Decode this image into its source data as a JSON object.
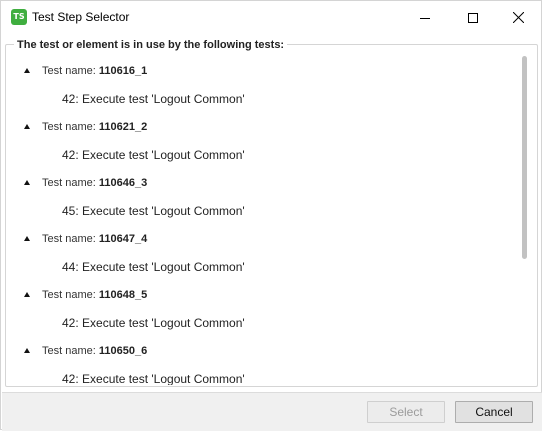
{
  "window": {
    "title": "Test Step Selector",
    "app_icon_text": "TS",
    "app_icon_color": "#3fae3f"
  },
  "group": {
    "header": "The test or element is in use by the following tests:"
  },
  "tests": [
    {
      "prefix": "Test name: ",
      "name": "110616_1",
      "step": "42: Execute test 'Logout Common'"
    },
    {
      "prefix": "Test name: ",
      "name": "110621_2",
      "step": "42: Execute test 'Logout Common'"
    },
    {
      "prefix": "Test name: ",
      "name": "110646_3",
      "step": "45: Execute test 'Logout Common'"
    },
    {
      "prefix": "Test name: ",
      "name": "110647_4",
      "step": "44: Execute test 'Logout Common'"
    },
    {
      "prefix": "Test name: ",
      "name": "110648_5",
      "step": "42: Execute test 'Logout Common'"
    },
    {
      "prefix": "Test name: ",
      "name": "110650_6",
      "step": "42: Execute test 'Logout Common'"
    }
  ],
  "buttons": {
    "select_label": "Select",
    "select_enabled": false,
    "cancel_label": "Cancel"
  }
}
